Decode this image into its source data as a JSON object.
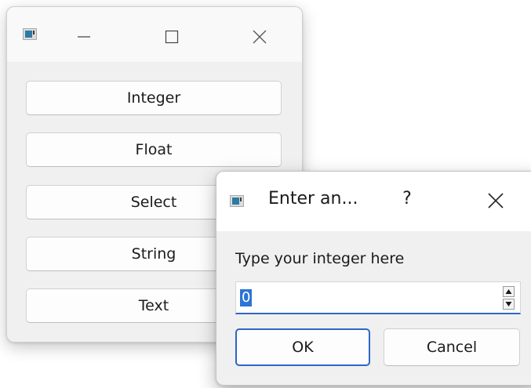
{
  "main_window": {
    "buttons": [
      "Integer",
      "Float",
      "Select",
      "String",
      "Text"
    ]
  },
  "dialog": {
    "title": "Enter an...",
    "help_label": "?",
    "prompt": "Type your integer here",
    "input": {
      "value": "0"
    },
    "ok_label": "OK",
    "cancel_label": "Cancel"
  },
  "icons": {
    "app": "app-window-icon",
    "minimize": "minimize-icon",
    "maximize": "maximize-icon",
    "close": "close-icon",
    "spin_up": "triangle-up-icon",
    "spin_down": "triangle-down-icon"
  },
  "colors": {
    "accent": "#2f66c7",
    "selection": "#2c74d6",
    "window_bg": "#f0f0f0",
    "titlebar_bg": "#f9f9f9"
  }
}
